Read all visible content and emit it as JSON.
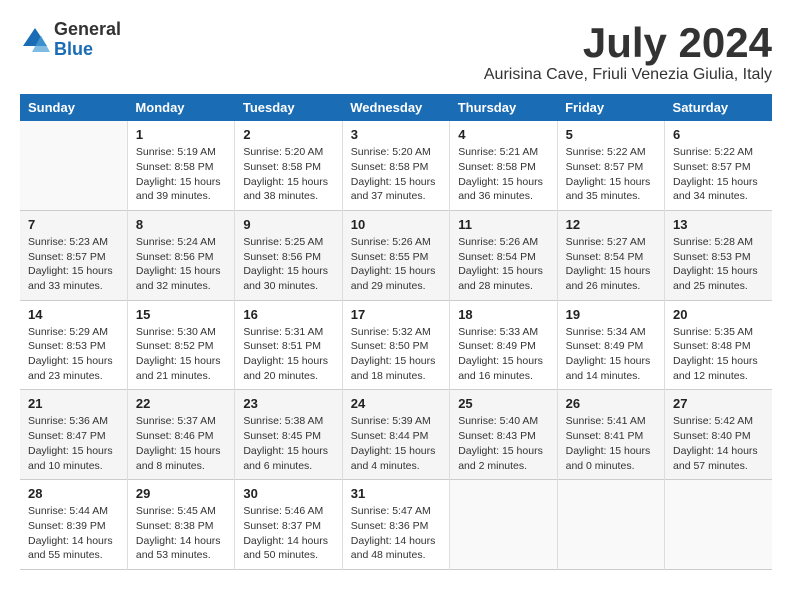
{
  "logo": {
    "line1": "General",
    "line2": "Blue"
  },
  "title": "July 2024",
  "location": "Aurisina Cave, Friuli Venezia Giulia, Italy",
  "headers": [
    "Sunday",
    "Monday",
    "Tuesday",
    "Wednesday",
    "Thursday",
    "Friday",
    "Saturday"
  ],
  "weeks": [
    [
      {
        "day": "",
        "info": ""
      },
      {
        "day": "1",
        "info": "Sunrise: 5:19 AM\nSunset: 8:58 PM\nDaylight: 15 hours\nand 39 minutes."
      },
      {
        "day": "2",
        "info": "Sunrise: 5:20 AM\nSunset: 8:58 PM\nDaylight: 15 hours\nand 38 minutes."
      },
      {
        "day": "3",
        "info": "Sunrise: 5:20 AM\nSunset: 8:58 PM\nDaylight: 15 hours\nand 37 minutes."
      },
      {
        "day": "4",
        "info": "Sunrise: 5:21 AM\nSunset: 8:58 PM\nDaylight: 15 hours\nand 36 minutes."
      },
      {
        "day": "5",
        "info": "Sunrise: 5:22 AM\nSunset: 8:57 PM\nDaylight: 15 hours\nand 35 minutes."
      },
      {
        "day": "6",
        "info": "Sunrise: 5:22 AM\nSunset: 8:57 PM\nDaylight: 15 hours\nand 34 minutes."
      }
    ],
    [
      {
        "day": "7",
        "info": "Sunrise: 5:23 AM\nSunset: 8:57 PM\nDaylight: 15 hours\nand 33 minutes."
      },
      {
        "day": "8",
        "info": "Sunrise: 5:24 AM\nSunset: 8:56 PM\nDaylight: 15 hours\nand 32 minutes."
      },
      {
        "day": "9",
        "info": "Sunrise: 5:25 AM\nSunset: 8:56 PM\nDaylight: 15 hours\nand 30 minutes."
      },
      {
        "day": "10",
        "info": "Sunrise: 5:26 AM\nSunset: 8:55 PM\nDaylight: 15 hours\nand 29 minutes."
      },
      {
        "day": "11",
        "info": "Sunrise: 5:26 AM\nSunset: 8:54 PM\nDaylight: 15 hours\nand 28 minutes."
      },
      {
        "day": "12",
        "info": "Sunrise: 5:27 AM\nSunset: 8:54 PM\nDaylight: 15 hours\nand 26 minutes."
      },
      {
        "day": "13",
        "info": "Sunrise: 5:28 AM\nSunset: 8:53 PM\nDaylight: 15 hours\nand 25 minutes."
      }
    ],
    [
      {
        "day": "14",
        "info": "Sunrise: 5:29 AM\nSunset: 8:53 PM\nDaylight: 15 hours\nand 23 minutes."
      },
      {
        "day": "15",
        "info": "Sunrise: 5:30 AM\nSunset: 8:52 PM\nDaylight: 15 hours\nand 21 minutes."
      },
      {
        "day": "16",
        "info": "Sunrise: 5:31 AM\nSunset: 8:51 PM\nDaylight: 15 hours\nand 20 minutes."
      },
      {
        "day": "17",
        "info": "Sunrise: 5:32 AM\nSunset: 8:50 PM\nDaylight: 15 hours\nand 18 minutes."
      },
      {
        "day": "18",
        "info": "Sunrise: 5:33 AM\nSunset: 8:49 PM\nDaylight: 15 hours\nand 16 minutes."
      },
      {
        "day": "19",
        "info": "Sunrise: 5:34 AM\nSunset: 8:49 PM\nDaylight: 15 hours\nand 14 minutes."
      },
      {
        "day": "20",
        "info": "Sunrise: 5:35 AM\nSunset: 8:48 PM\nDaylight: 15 hours\nand 12 minutes."
      }
    ],
    [
      {
        "day": "21",
        "info": "Sunrise: 5:36 AM\nSunset: 8:47 PM\nDaylight: 15 hours\nand 10 minutes."
      },
      {
        "day": "22",
        "info": "Sunrise: 5:37 AM\nSunset: 8:46 PM\nDaylight: 15 hours\nand 8 minutes."
      },
      {
        "day": "23",
        "info": "Sunrise: 5:38 AM\nSunset: 8:45 PM\nDaylight: 15 hours\nand 6 minutes."
      },
      {
        "day": "24",
        "info": "Sunrise: 5:39 AM\nSunset: 8:44 PM\nDaylight: 15 hours\nand 4 minutes."
      },
      {
        "day": "25",
        "info": "Sunrise: 5:40 AM\nSunset: 8:43 PM\nDaylight: 15 hours\nand 2 minutes."
      },
      {
        "day": "26",
        "info": "Sunrise: 5:41 AM\nSunset: 8:41 PM\nDaylight: 15 hours\nand 0 minutes."
      },
      {
        "day": "27",
        "info": "Sunrise: 5:42 AM\nSunset: 8:40 PM\nDaylight: 14 hours\nand 57 minutes."
      }
    ],
    [
      {
        "day": "28",
        "info": "Sunrise: 5:44 AM\nSunset: 8:39 PM\nDaylight: 14 hours\nand 55 minutes."
      },
      {
        "day": "29",
        "info": "Sunrise: 5:45 AM\nSunset: 8:38 PM\nDaylight: 14 hours\nand 53 minutes."
      },
      {
        "day": "30",
        "info": "Sunrise: 5:46 AM\nSunset: 8:37 PM\nDaylight: 14 hours\nand 50 minutes."
      },
      {
        "day": "31",
        "info": "Sunrise: 5:47 AM\nSunset: 8:36 PM\nDaylight: 14 hours\nand 48 minutes."
      },
      {
        "day": "",
        "info": ""
      },
      {
        "day": "",
        "info": ""
      },
      {
        "day": "",
        "info": ""
      }
    ]
  ]
}
